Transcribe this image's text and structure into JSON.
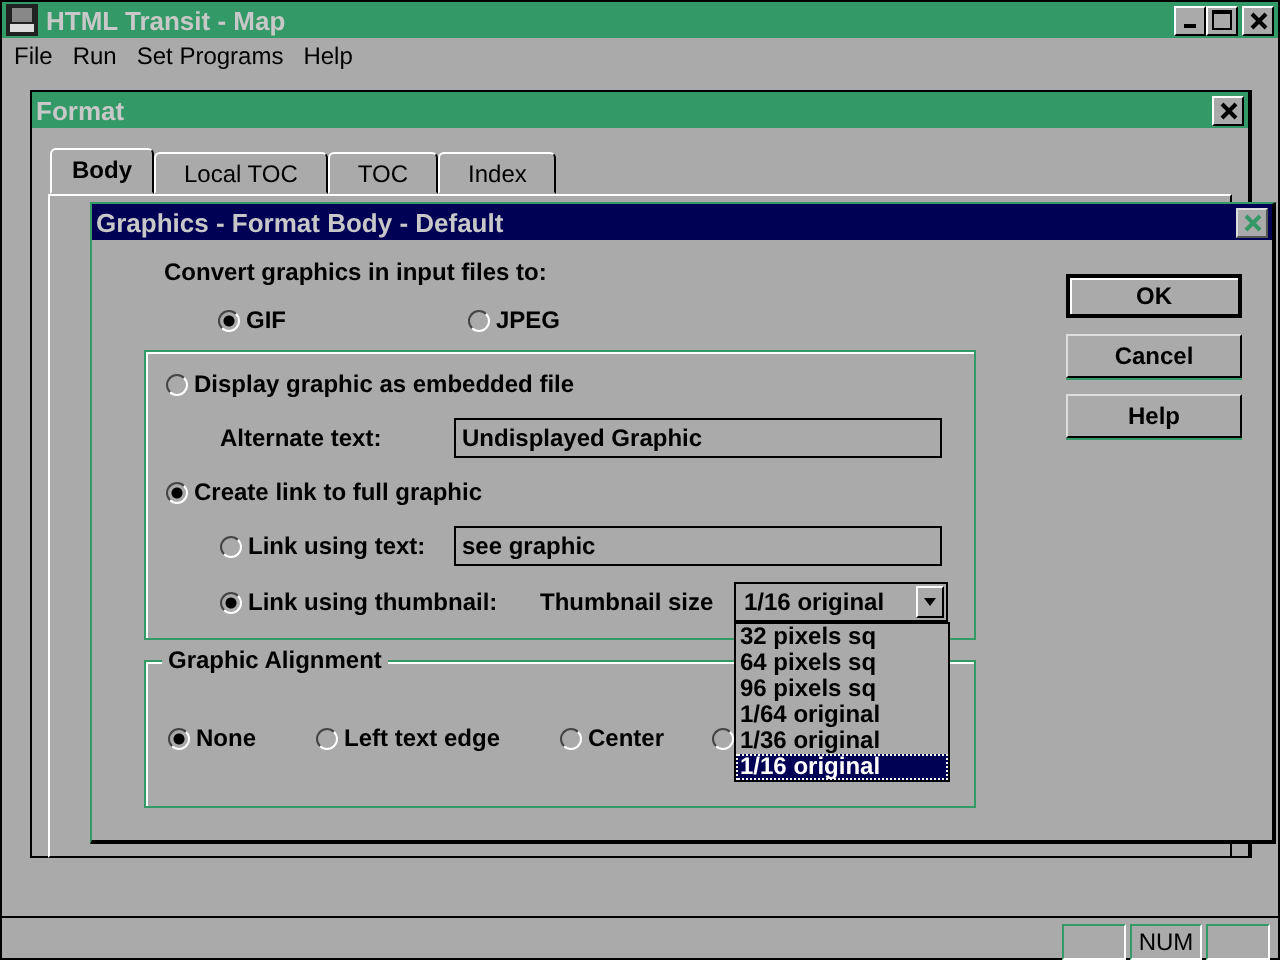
{
  "main_window": {
    "title": "HTML Transit - Map",
    "menu": [
      "File",
      "Run",
      "Set Programs",
      "Help"
    ],
    "status_bar": {
      "num": "NUM"
    }
  },
  "format_dialog": {
    "title": "Format",
    "tabs": [
      {
        "label": "Body",
        "selected": true
      },
      {
        "label": "Local TOC",
        "selected": false
      },
      {
        "label": "TOC",
        "selected": false
      },
      {
        "label": "Index",
        "selected": false
      }
    ]
  },
  "graphics_dialog": {
    "title": "Graphics -  Format Body - Default",
    "convert_label": "Convert graphics in input files to:",
    "formats": [
      {
        "label": "GIF",
        "selected": true
      },
      {
        "label": "JPEG",
        "selected": false
      }
    ],
    "display_options": [
      {
        "label": "Display graphic as embedded file",
        "selected": false
      },
      {
        "label": "Create link to full graphic",
        "selected": true
      }
    ],
    "alternate_text": {
      "label": "Alternate text:",
      "value": "Undisplayed Graphic"
    },
    "link_options": [
      {
        "label": "Link using text:",
        "selected": false,
        "value": "see graphic"
      },
      {
        "label": "Link using thumbnail:",
        "selected": true
      }
    ],
    "thumbnail_size": {
      "label": "Thumbnail size",
      "value": "1/16 original",
      "expanded": true,
      "options": [
        {
          "label": "32 pixels sq",
          "selected": false
        },
        {
          "label": "64 pixels sq",
          "selected": false
        },
        {
          "label": "96 pixels sq",
          "selected": false
        },
        {
          "label": "1/64 original",
          "selected": false
        },
        {
          "label": "1/36 original",
          "selected": false
        },
        {
          "label": "1/16 original",
          "selected": true
        }
      ]
    },
    "alignment": {
      "title": "Graphic Alignment",
      "options": [
        {
          "label": "None",
          "selected": true
        },
        {
          "label": "Left text edge",
          "selected": false
        },
        {
          "label": "Center",
          "selected": false
        },
        {
          "selected": false
        }
      ]
    },
    "buttons": [
      {
        "label": "OK",
        "default": true
      },
      {
        "label": "Cancel",
        "default": false
      },
      {
        "label": "Help",
        "default": false
      }
    ]
  }
}
